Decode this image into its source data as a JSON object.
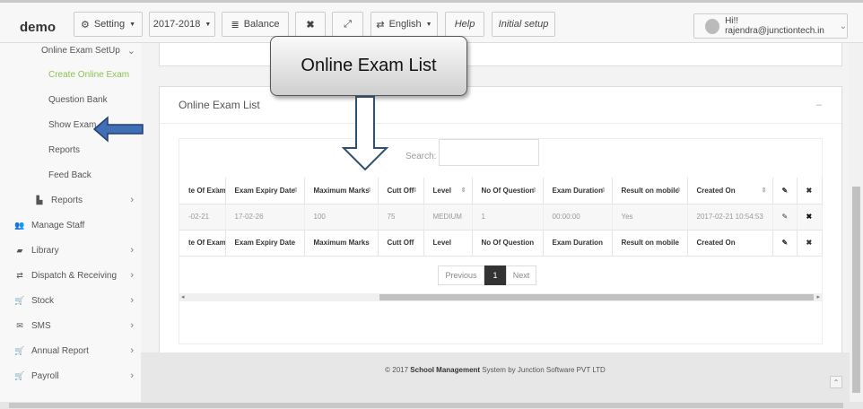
{
  "header": {
    "brand": "demo",
    "setting_label": "Setting",
    "year_label": "2017-2018",
    "balance_label": "Balance",
    "language_label": "English",
    "help_label": "Help",
    "initial_setup_label": "Initial setup",
    "user_label": "Hi!! rajendra@junctiontech.in"
  },
  "sidebar": {
    "online_exam_setup": "Online Exam SetUp",
    "create_online_exam": "Create Online Exam",
    "question_bank": "Question Bank",
    "show_exam": "Show Exam",
    "reports": "Reports",
    "feed_back": "Feed Back",
    "reports_group": "Reports",
    "manage_staff": "Manage Staff",
    "library": "Library",
    "dispatch_receiving": "Dispatch & Receiving",
    "stock": "Stock",
    "sms": "SMS",
    "annual_report": "Annual Report",
    "payroll": "Payroll"
  },
  "panel": {
    "title": "Online Exam List",
    "minimize": "–",
    "search_label": "Search:",
    "search_value": ""
  },
  "table": {
    "headers": [
      "te Of Exam",
      "Exam Expiry Date",
      "Maximum Marks",
      "Cutt Off",
      "Level",
      "No Of Question",
      "Exam Duration",
      "Result on mobile",
      "Created On"
    ],
    "row": [
      "-02-21",
      "17-02-26",
      "100",
      "75",
      "MEDIUM",
      "1",
      "00:00:00",
      "Yes",
      "2017-02-21 10:54:53"
    ],
    "footers": [
      "te Of Exam",
      "Exam Expiry Date",
      "Maximum Marks",
      "Cutt Off",
      "Level",
      "No Of Question",
      "Exam Duration",
      "Result on mobile",
      "Created On"
    ]
  },
  "pagination": {
    "previous": "Previous",
    "current": "1",
    "next": "Next"
  },
  "footer": {
    "prefix": "© 2017 ",
    "bold": "School Management",
    "suffix": " System by Junction Software PVT LTD"
  },
  "annotation": {
    "callout": "Online Exam List"
  },
  "colors": {
    "accent_green": "#8cc152",
    "arrow_blue": "#3f6fb5",
    "active_page": "#333333"
  }
}
